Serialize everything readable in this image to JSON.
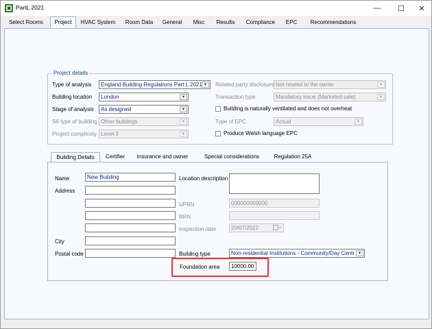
{
  "window": {
    "title": "PartL 2021",
    "controls": {
      "minimize": "—",
      "maximize": "☐",
      "close": "✕"
    }
  },
  "main_tabs": [
    "Select Rooms",
    "Project",
    "HVAC System",
    "Room Data",
    "General",
    "Misc",
    "Results",
    "Compliance",
    "EPC",
    "Recommendations"
  ],
  "active_main_tab": "Project",
  "project_details": {
    "title": "Project details",
    "type_of_analysis": {
      "label": "Type of analysis",
      "value": "England Building Regulations Part L 2021"
    },
    "building_location": {
      "label": "Building location",
      "value": "London"
    },
    "stage_of_analysis": {
      "label": "Stage of analysis",
      "value": "As designed"
    },
    "s6_type_of_building": {
      "label": "S6 type of building",
      "value": "Other buildings"
    },
    "project_complexity": {
      "label": "Project complexity",
      "value": "Level 3"
    },
    "related_party_disclosure": {
      "label": "Related party disclosure",
      "value": "Not related to the owner"
    },
    "transaction_type": {
      "label": "Transaction type",
      "value": "Mandatory issue (Marketed sale)"
    },
    "naturally_ventilated": {
      "label": "Building is naturally ventilated and does not overheat",
      "checked": false
    },
    "type_of_epc": {
      "label": "Type of EPC",
      "value": "Actual"
    },
    "welsh_epc": {
      "label": "Produce Welsh language EPC",
      "checked": false
    }
  },
  "inner_tabs": [
    "Building Details",
    "Certifier",
    "Insurance and owner",
    "Special considerations",
    "Regulation 25A"
  ],
  "active_inner_tab": "Building Details",
  "building_details": {
    "name": {
      "label": "Name",
      "value": "New Building"
    },
    "address": {
      "label": "Address",
      "lines": [
        "",
        "",
        "",
        ""
      ]
    },
    "city": {
      "label": "City",
      "value": ""
    },
    "postal_code": {
      "label": "Postal code",
      "value": ""
    },
    "location_description": {
      "label": "Location description",
      "value": ""
    },
    "uprn": {
      "label": "UPRN",
      "value": "000000000000"
    },
    "rrn": {
      "label": "RRN",
      "value": ""
    },
    "inspection_date": {
      "label": "Inspection date",
      "value": "20/07/2022"
    },
    "building_type": {
      "label": "Building type",
      "value": "Non-residential Institutions - Community/Day Centre"
    },
    "foundation_area": {
      "label": "Foundation area",
      "value": "10000.00"
    }
  },
  "icons": {
    "app": "app-logo-icon",
    "dropdown": "chevron-down-icon",
    "calendar": "calendar-icon"
  },
  "colors": {
    "group_title": "#1f3a8a",
    "highlight": "#d0393b",
    "selected_text": "#1a237e"
  }
}
